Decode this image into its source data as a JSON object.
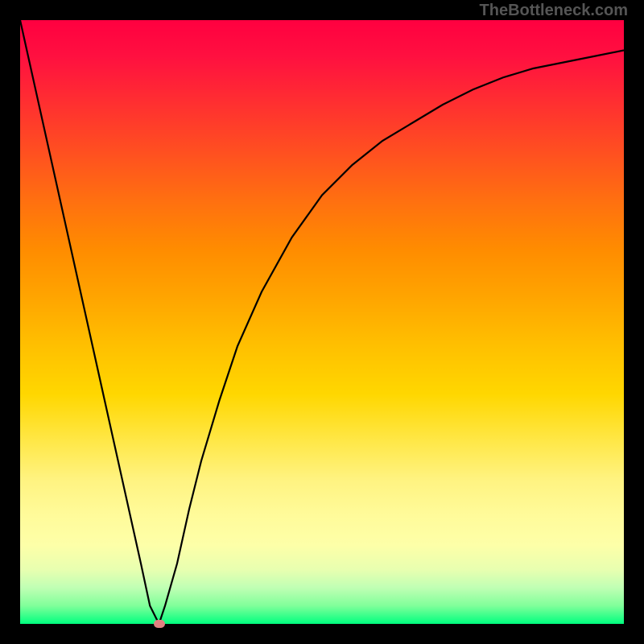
{
  "watermark": "TheBottleneck.com",
  "colors": {
    "background": "#000000",
    "gradient_top": "#ff0040",
    "gradient_bottom": "#00ff7f",
    "curve": "#000000",
    "marker": "#e08080"
  },
  "chart_data": {
    "type": "line",
    "title": "",
    "xlabel": "",
    "ylabel": "",
    "xlim": [
      0,
      100
    ],
    "ylim": [
      0,
      100
    ],
    "x": [
      0,
      2,
      4,
      6,
      8,
      10,
      12,
      14,
      16,
      18,
      20,
      21.5,
      23,
      24,
      26,
      28,
      30,
      33,
      36,
      40,
      45,
      50,
      55,
      60,
      65,
      70,
      75,
      80,
      85,
      90,
      95,
      100
    ],
    "values": [
      100,
      91,
      82,
      73,
      64,
      55,
      46,
      37,
      28,
      19,
      10,
      3,
      0,
      3,
      10,
      19,
      27,
      37,
      46,
      55,
      64,
      71,
      76,
      80,
      83,
      86,
      88.5,
      90.5,
      92,
      93,
      94,
      95
    ],
    "minimum_marker": {
      "x": 23,
      "y": 0
    },
    "annotations": []
  }
}
